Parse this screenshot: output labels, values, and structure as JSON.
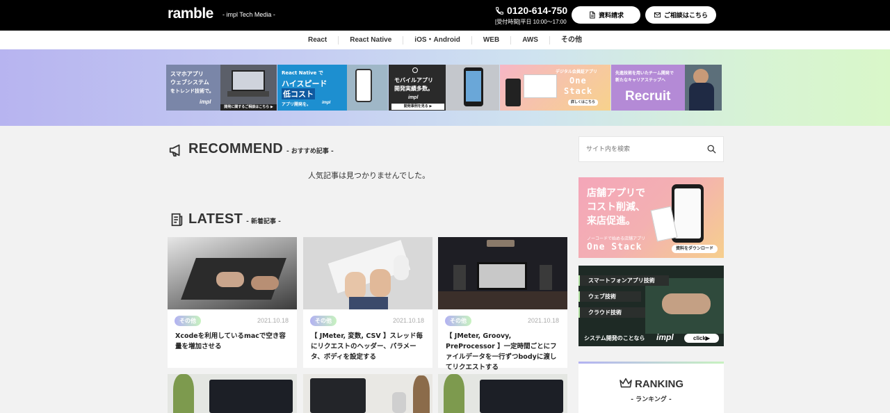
{
  "header": {
    "logo": "ramble",
    "tagline": "- impl Tech Media -",
    "phone": "0120-614-750",
    "hours": "[受付時間]平日 10:00〜17:00",
    "doc_button": "資料請求",
    "contact_button": "ご相談はこちら"
  },
  "nav": {
    "items": [
      "React",
      "React Native",
      "iOS・Android",
      "WEB",
      "AWS",
      "その他"
    ]
  },
  "banners": [
    {
      "line1": "スマホアプリ",
      "line2": "ウェブシステム",
      "line3": "をトレンド技術で。",
      "footer": "開発に関するご相談はこちら ▶",
      "brand": "impl"
    },
    {
      "line1": "React Native で",
      "line2": "ハイスピード",
      "line3": "低コスト",
      "line4": "アプリ開発を。",
      "brand": "impl"
    },
    {
      "line1": "モバイルアプリ",
      "line2": "開発実績多数。",
      "brand": "impl",
      "footer": "開発事例を見る ▶"
    },
    {
      "line1": "デジタル会員証アプリ",
      "line2": "One",
      "line3": "Stack",
      "footer": "詳しくはこちら"
    },
    {
      "line1": "先進技術を用いたチーム開発で",
      "line2": "新たなキャリアステップへ",
      "line3": "Recruit"
    }
  ],
  "recommend": {
    "title": "RECOMMEND",
    "subtitle": "- おすすめ記事 -",
    "empty": "人気記事は見つかりませんでした。"
  },
  "latest": {
    "title": "LATEST",
    "subtitle": "- 新着記事 -",
    "cards": [
      {
        "tag": "その他",
        "date": "2021.10.18",
        "title": "Xcodeを利用しているmacで空き容量を増加させる"
      },
      {
        "tag": "その他",
        "date": "2021.10.18",
        "title": "【 JMeter, 変数, CSV 】スレッド毎にリクエストのヘッダー、パラメータ、ボディを設定する"
      },
      {
        "tag": "その他",
        "date": "2021.10.18",
        "title": "【 JMeter, Groovy, PreProcessor 】一定時間ごとにファイルデータを一行ずつbodyに渡してリクエストする"
      }
    ]
  },
  "sidebar": {
    "search_placeholder": "サイト内を検索",
    "ad1": {
      "line1": "店舗アプリで",
      "line2": "コスト削減、",
      "line3": "来店促進。",
      "small": "ノーコードで始める店舗アプリ",
      "product": "One Stack",
      "cta": "資料をダウンロード"
    },
    "ad2": {
      "item1": "スマートフォンアプリ技術",
      "item2": "ウェブ技術",
      "item3": "クラウド技術",
      "footer": "システム開発のことなら",
      "brand": "impl",
      "cta": "click▶"
    },
    "ranking_title": "RANKING",
    "ranking_subtitle": "- ランキング -"
  },
  "colors": {
    "header_bg": "#000000",
    "tag_gradient_start": "#b3b2f2",
    "tag_gradient_end": "#c8f2c0",
    "page_bg": "#f2f2f2"
  }
}
